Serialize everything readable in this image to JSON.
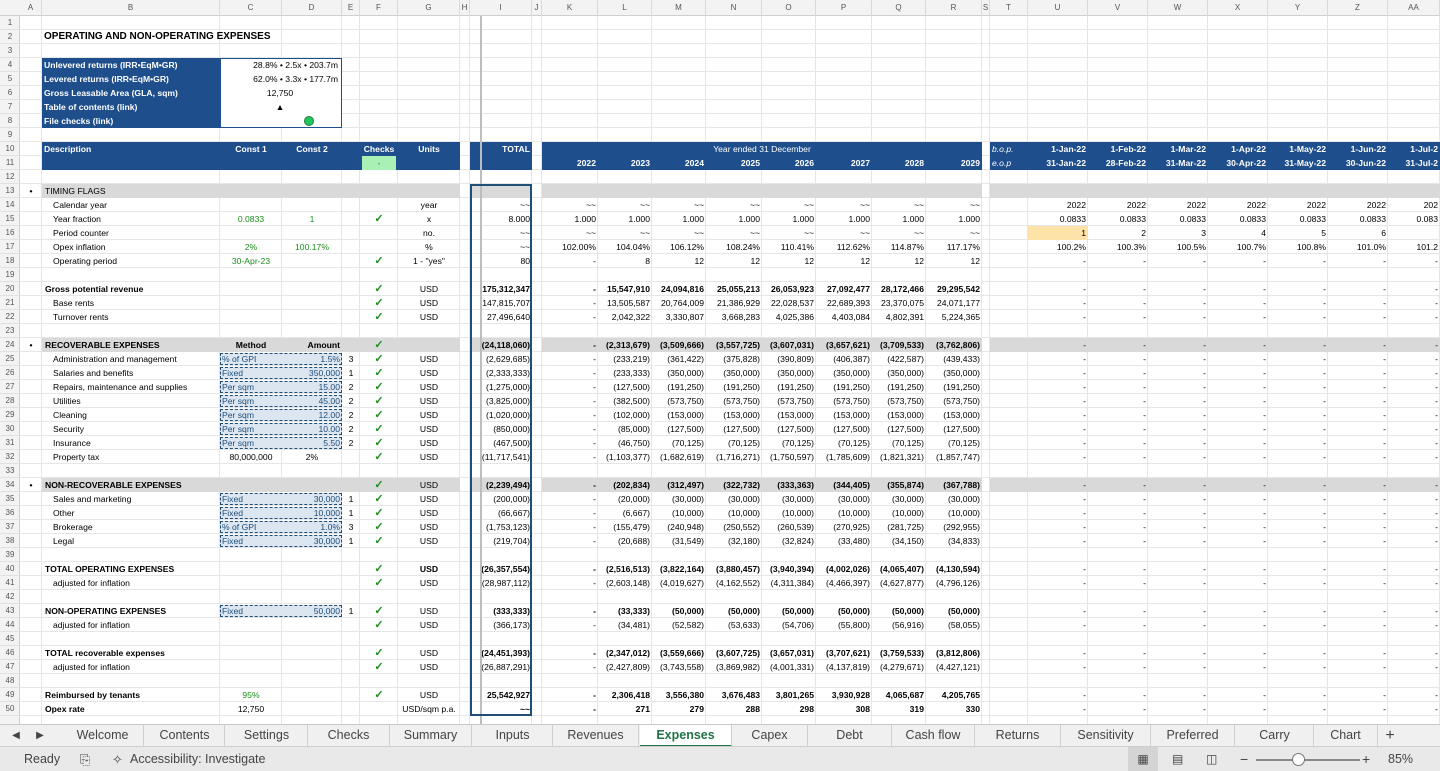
{
  "columns": [
    "A",
    "B",
    "C",
    "D",
    "E",
    "F",
    "G",
    "H",
    "I",
    "J",
    "K",
    "L",
    "M",
    "N",
    "O",
    "P",
    "Q",
    "R",
    "S",
    "T",
    "U",
    "V",
    "W",
    "X",
    "Y",
    "Z",
    "AA"
  ],
  "rows": [
    "1",
    "2",
    "3",
    "4",
    "5",
    "6",
    "7",
    "8",
    "9",
    "10",
    "11",
    "12",
    "13",
    "14",
    "15",
    "16",
    "17",
    "18",
    "19",
    "20",
    "21",
    "22",
    "23",
    "24",
    "25",
    "26",
    "27",
    "28",
    "29",
    "30",
    "31",
    "32",
    "33",
    "34",
    "35",
    "36",
    "37",
    "38",
    "39",
    "40",
    "41",
    "42",
    "43",
    "44",
    "45",
    "46",
    "47",
    "48",
    "49",
    "50"
  ],
  "title": "OPERATING AND NON-OPERATING EXPENSES",
  "summary": [
    {
      "label": "Unlevered returns (IRR•EqM•GR)",
      "value": "28.8% • 2.5x • 203.7m"
    },
    {
      "label": "Levered returns (IRR•EqM•GR)",
      "value": "62.0% • 3.3x • 177.7m"
    },
    {
      "label": "Gross Leasable Area (GLA, sqm)",
      "value": "12,750"
    },
    {
      "label": "Table of contents (link)",
      "value": "▲"
    },
    {
      "label": "File checks (link)",
      "value": ""
    }
  ],
  "header": {
    "description": "Description",
    "const1": "Const 1",
    "const2": "Const 2",
    "checks": "Checks",
    "units": "Units",
    "total": "TOTAL",
    "year_ended": "Year ended 31 December",
    "checks_value": "-",
    "bop": "b.o.p.",
    "eop": "e.o.p"
  },
  "years": [
    "2022",
    "2023",
    "2024",
    "2025",
    "2026",
    "2027",
    "2028",
    "2029"
  ],
  "months_bop": [
    "1-Jan-22",
    "1-Feb-22",
    "1-Mar-22",
    "1-Apr-22",
    "1-May-22",
    "1-Jun-22",
    "1-Jul-2"
  ],
  "months_eop": [
    "31-Jan-22",
    "28-Feb-22",
    "31-Mar-22",
    "30-Apr-22",
    "31-May-22",
    "30-Jun-22",
    "31-Jul-2"
  ],
  "body": [
    {
      "row": 13,
      "style": "grey",
      "bullet": "•",
      "b": "TIMING FLAGS"
    },
    {
      "row": 14,
      "b": "Calendar year",
      "g": "year",
      "i": "~~",
      "years": [
        "~~",
        "~~",
        "~~",
        "~~",
        "~~",
        "~~",
        "~~",
        "~~"
      ],
      "months": [
        "2022",
        "2022",
        "2022",
        "2022",
        "2022",
        "2022",
        "202"
      ]
    },
    {
      "row": 15,
      "b": "Year fraction",
      "c": "0.0833",
      "d": "1",
      "f": "✓",
      "g": "x",
      "i": "8.000",
      "years": [
        "1.000",
        "1.000",
        "1.000",
        "1.000",
        "1.000",
        "1.000",
        "1.000",
        "1.000"
      ],
      "months": [
        "0.0833",
        "0.0833",
        "0.0833",
        "0.0833",
        "0.0833",
        "0.0833",
        "0.083"
      ]
    },
    {
      "row": 16,
      "b": "Period counter",
      "g": "no.",
      "i": "~~",
      "years": [
        "~~",
        "~~",
        "~~",
        "~~",
        "~~",
        "~~",
        "~~",
        "~~"
      ],
      "months": [
        "1",
        "2",
        "3",
        "4",
        "5",
        "6",
        ""
      ]
    },
    {
      "row": 17,
      "b": "Opex inflation",
      "c": "2%",
      "d": "100.17%",
      "g": "%",
      "i": "~~",
      "years": [
        "102.00%",
        "104.04%",
        "106.12%",
        "108.24%",
        "110.41%",
        "112.62%",
        "114.87%",
        "117.17%"
      ],
      "months": [
        "100.2%",
        "100.3%",
        "100.5%",
        "100.7%",
        "100.8%",
        "101.0%",
        "101.2"
      ]
    },
    {
      "row": 18,
      "b": "Operating period",
      "c": "30-Apr-23",
      "f": "✓",
      "g": "1 - \"yes\"",
      "i": "80",
      "years": [
        "-",
        "8",
        "12",
        "12",
        "12",
        "12",
        "12",
        "12"
      ],
      "months": [
        "-",
        "-",
        "-",
        "-",
        "-",
        "-",
        "-"
      ]
    },
    {
      "row": 20,
      "bold": true,
      "b": "Gross potential revenue",
      "f": "✓",
      "g": "USD",
      "i": "175,312,347",
      "years": [
        "-",
        "15,547,910",
        "24,094,816",
        "25,055,213",
        "26,053,923",
        "27,092,477",
        "28,172,466",
        "29,295,542"
      ],
      "months": [
        "-",
        "-",
        "-",
        "-",
        "-",
        "-",
        "-"
      ]
    },
    {
      "row": 21,
      "b": "Base rents",
      "f": "✓",
      "g": "USD",
      "i": "147,815,707",
      "years": [
        "-",
        "13,505,587",
        "20,764,009",
        "21,386,929",
        "22,028,537",
        "22,689,393",
        "23,370,075",
        "24,071,177"
      ],
      "months": [
        "-",
        "-",
        "-",
        "-",
        "-",
        "-",
        "-"
      ]
    },
    {
      "row": 22,
      "b": "Turnover rents",
      "f": "✓",
      "g": "USD",
      "i": "27,496,640",
      "years": [
        "-",
        "2,042,322",
        "3,330,807",
        "3,668,283",
        "4,025,386",
        "4,403,084",
        "4,802,391",
        "5,224,365"
      ],
      "months": [
        "-",
        "-",
        "-",
        "-",
        "-",
        "-",
        "-"
      ]
    },
    {
      "row": 24,
      "style": "grey",
      "bold": true,
      "bullet": "•",
      "b": "RECOVERABLE EXPENSES",
      "c": "Method",
      "d": "Amount",
      "f": "✓",
      "i": "(24,118,060)",
      "years": [
        "-",
        "(2,313,679)",
        "(3,509,666)",
        "(3,557,725)",
        "(3,607,031)",
        "(3,657,621)",
        "(3,709,533)",
        "(3,762,806)"
      ],
      "months": [
        "-",
        "-",
        "-",
        "-",
        "-",
        "-",
        "-"
      ]
    },
    {
      "row": 25,
      "b": "Administration and management",
      "c": "% of GPI",
      "d": "1.5%",
      "e": "3",
      "f": "✓",
      "g": "USD",
      "i": "(2,629,685)",
      "years": [
        "-",
        "(233,219)",
        "(361,422)",
        "(375,828)",
        "(390,809)",
        "(406,387)",
        "(422,587)",
        "(439,433)"
      ],
      "months": [
        "-",
        "-",
        "-",
        "-",
        "-",
        "-",
        "-"
      ]
    },
    {
      "row": 26,
      "b": "Salaries and benefits",
      "c": "Fixed",
      "d": "350,000",
      "e": "1",
      "f": "✓",
      "g": "USD",
      "i": "(2,333,333)",
      "years": [
        "-",
        "(233,333)",
        "(350,000)",
        "(350,000)",
        "(350,000)",
        "(350,000)",
        "(350,000)",
        "(350,000)"
      ],
      "months": [
        "-",
        "-",
        "-",
        "-",
        "-",
        "-",
        "-"
      ]
    },
    {
      "row": 27,
      "b": "Repairs, maintenance and supplies",
      "c": "Per sqm",
      "d": "15.00",
      "e": "2",
      "f": "✓",
      "g": "USD",
      "i": "(1,275,000)",
      "years": [
        "-",
        "(127,500)",
        "(191,250)",
        "(191,250)",
        "(191,250)",
        "(191,250)",
        "(191,250)",
        "(191,250)"
      ],
      "months": [
        "-",
        "-",
        "-",
        "-",
        "-",
        "-",
        "-"
      ]
    },
    {
      "row": 28,
      "b": "Utilities",
      "c": "Per sqm",
      "d": "45.00",
      "e": "2",
      "f": "✓",
      "g": "USD",
      "i": "(3,825,000)",
      "years": [
        "-",
        "(382,500)",
        "(573,750)",
        "(573,750)",
        "(573,750)",
        "(573,750)",
        "(573,750)",
        "(573,750)"
      ],
      "months": [
        "-",
        "-",
        "-",
        "-",
        "-",
        "-",
        "-"
      ]
    },
    {
      "row": 29,
      "b": "Cleaning",
      "c": "Per sqm",
      "d": "12.00",
      "e": "2",
      "f": "✓",
      "g": "USD",
      "i": "(1,020,000)",
      "years": [
        "-",
        "(102,000)",
        "(153,000)",
        "(153,000)",
        "(153,000)",
        "(153,000)",
        "(153,000)",
        "(153,000)"
      ],
      "months": [
        "-",
        "-",
        "-",
        "-",
        "-",
        "-",
        "-"
      ]
    },
    {
      "row": 30,
      "b": "Security",
      "c": "Per sqm",
      "d": "10.00",
      "e": "2",
      "f": "✓",
      "g": "USD",
      "i": "(850,000)",
      "years": [
        "-",
        "(85,000)",
        "(127,500)",
        "(127,500)",
        "(127,500)",
        "(127,500)",
        "(127,500)",
        "(127,500)"
      ],
      "months": [
        "-",
        "-",
        "-",
        "-",
        "-",
        "-",
        "-"
      ]
    },
    {
      "row": 31,
      "b": "Insurance",
      "c": "Per sqm",
      "d": "5.50",
      "e": "2",
      "f": "✓",
      "g": "USD",
      "i": "(467,500)",
      "years": [
        "-",
        "(46,750)",
        "(70,125)",
        "(70,125)",
        "(70,125)",
        "(70,125)",
        "(70,125)",
        "(70,125)"
      ],
      "months": [
        "-",
        "-",
        "-",
        "-",
        "-",
        "-",
        "-"
      ]
    },
    {
      "row": 32,
      "b": "Property tax",
      "c": "80,000,000",
      "d": "2%",
      "f": "✓",
      "g": "USD",
      "i": "(11,717,541)",
      "years": [
        "-",
        "(1,103,377)",
        "(1,682,619)",
        "(1,716,271)",
        "(1,750,597)",
        "(1,785,609)",
        "(1,821,321)",
        "(1,857,747)"
      ],
      "months": [
        "-",
        "-",
        "-",
        "-",
        "-",
        "-",
        "-"
      ]
    },
    {
      "row": 34,
      "style": "grey",
      "bold": true,
      "bullet": "•",
      "b": "NON-RECOVERABLE EXPENSES",
      "f": "✓",
      "g": "USD",
      "i": "(2,239,494)",
      "years": [
        "-",
        "(202,834)",
        "(312,497)",
        "(322,732)",
        "(333,363)",
        "(344,405)",
        "(355,874)",
        "(367,788)"
      ],
      "months": [
        "-",
        "-",
        "-",
        "-",
        "-",
        "-",
        "-"
      ]
    },
    {
      "row": 35,
      "b": "Sales and marketing",
      "c": "Fixed",
      "d": "30,000",
      "e": "1",
      "f": "✓",
      "g": "USD",
      "i": "(200,000)",
      "years": [
        "-",
        "(20,000)",
        "(30,000)",
        "(30,000)",
        "(30,000)",
        "(30,000)",
        "(30,000)",
        "(30,000)"
      ],
      "months": [
        "-",
        "-",
        "-",
        "-",
        "-",
        "-",
        "-"
      ]
    },
    {
      "row": 36,
      "b": "Other",
      "c": "Fixed",
      "d": "10,000",
      "e": "1",
      "f": "✓",
      "g": "USD",
      "i": "(66,667)",
      "years": [
        "-",
        "(6,667)",
        "(10,000)",
        "(10,000)",
        "(10,000)",
        "(10,000)",
        "(10,000)",
        "(10,000)"
      ],
      "months": [
        "-",
        "-",
        "-",
        "-",
        "-",
        "-",
        "-"
      ]
    },
    {
      "row": 37,
      "b": "Brokerage",
      "c": "% of GPI",
      "d": "1.0%",
      "e": "3",
      "f": "✓",
      "g": "USD",
      "i": "(1,753,123)",
      "years": [
        "-",
        "(155,479)",
        "(240,948)",
        "(250,552)",
        "(260,539)",
        "(270,925)",
        "(281,725)",
        "(292,955)"
      ],
      "months": [
        "-",
        "-",
        "-",
        "-",
        "-",
        "-",
        "-"
      ]
    },
    {
      "row": 38,
      "b": "Legal",
      "c": "Fixed",
      "d": "30,000",
      "e": "1",
      "f": "✓",
      "g": "USD",
      "i": "(219,704)",
      "years": [
        "-",
        "(20,688)",
        "(31,549)",
        "(32,180)",
        "(32,824)",
        "(33,480)",
        "(34,150)",
        "(34,833)"
      ],
      "months": [
        "-",
        "-",
        "-",
        "-",
        "-",
        "-",
        "-"
      ]
    },
    {
      "row": 40,
      "bold": true,
      "b": "TOTAL OPERATING EXPENSES",
      "f": "✓",
      "g": "USD",
      "i": "(26,357,554)",
      "years": [
        "-",
        "(2,516,513)",
        "(3,822,164)",
        "(3,880,457)",
        "(3,940,394)",
        "(4,002,026)",
        "(4,065,407)",
        "(4,130,594)"
      ],
      "months": [
        "-",
        "-",
        "-",
        "-",
        "-",
        "-",
        "-"
      ]
    },
    {
      "row": 41,
      "b": "adjusted for inflation",
      "f": "✓",
      "g": "USD",
      "i": "(28,987,112)",
      "years": [
        "-",
        "(2,603,148)",
        "(4,019,627)",
        "(4,162,552)",
        "(4,311,384)",
        "(4,466,397)",
        "(4,627,877)",
        "(4,796,126)"
      ],
      "months": [
        "-",
        "-",
        "-",
        "-",
        "-",
        "-",
        "-"
      ]
    },
    {
      "row": 43,
      "bold": true,
      "b": "NON-OPERATING EXPENSES",
      "c": "Fixed",
      "d": "50,000",
      "e": "1",
      "f": "✓",
      "g": "USD",
      "i": "(333,333)",
      "years": [
        "-",
        "(33,333)",
        "(50,000)",
        "(50,000)",
        "(50,000)",
        "(50,000)",
        "(50,000)",
        "(50,000)"
      ],
      "months": [
        "-",
        "-",
        "-",
        "-",
        "-",
        "-",
        "-"
      ]
    },
    {
      "row": 44,
      "b": "adjusted for inflation",
      "f": "✓",
      "g": "USD",
      "i": "(366,173)",
      "years": [
        "-",
        "(34,481)",
        "(52,582)",
        "(53,633)",
        "(54,706)",
        "(55,800)",
        "(56,916)",
        "(58,055)"
      ],
      "months": [
        "-",
        "-",
        "-",
        "-",
        "-",
        "-",
        "-"
      ]
    },
    {
      "row": 46,
      "bold": true,
      "b": "TOTAL recoverable expenses",
      "f": "✓",
      "g": "USD",
      "i": "(24,451,393)",
      "years": [
        "-",
        "(2,347,012)",
        "(3,559,666)",
        "(3,607,725)",
        "(3,657,031)",
        "(3,707,621)",
        "(3,759,533)",
        "(3,812,806)"
      ],
      "months": [
        "-",
        "-",
        "-",
        "-",
        "-",
        "-",
        "-"
      ]
    },
    {
      "row": 47,
      "b": "adjusted for inflation",
      "f": "✓",
      "g": "USD",
      "i": "(26,887,291)",
      "years": [
        "-",
        "(2,427,809)",
        "(3,743,558)",
        "(3,869,982)",
        "(4,001,331)",
        "(4,137,819)",
        "(4,279,671)",
        "(4,427,121)"
      ],
      "months": [
        "-",
        "-",
        "-",
        "-",
        "-",
        "-",
        "-"
      ]
    },
    {
      "row": 49,
      "bold": true,
      "b": "Reimbursed by tenants",
      "c": "95%",
      "f": "✓",
      "g": "USD",
      "i": "25,542,927",
      "years": [
        "-",
        "2,306,418",
        "3,556,380",
        "3,676,483",
        "3,801,265",
        "3,930,928",
        "4,065,687",
        "4,205,765"
      ],
      "months": [
        "-",
        "-",
        "-",
        "-",
        "-",
        "-",
        "-"
      ]
    },
    {
      "row": 50,
      "bold": true,
      "b": "Opex rate",
      "c": "12,750",
      "g": "USD/sqm p.a.",
      "i": "~~",
      "years": [
        "-",
        "271",
        "279",
        "288",
        "298",
        "308",
        "319",
        "330"
      ],
      "months": [
        "-",
        "-",
        "-",
        "-",
        "-",
        "-",
        "-"
      ]
    }
  ],
  "tabs": [
    "Welcome",
    "Contents",
    "Settings",
    "Checks",
    "Summary",
    "Inputs",
    "Revenues",
    "Expenses",
    "Capex",
    "Debt",
    "Cash flow",
    "Returns",
    "Sensitivity",
    "Preferred",
    "Carry",
    "Chart"
  ],
  "active_tab": "Expenses",
  "status": {
    "ready": "Ready",
    "accessibility": "Accessibility: Investigate",
    "zoom": "85%"
  },
  "colors": {
    "header_blue": "#1e4e8c",
    "accent_green": "#217346",
    "check_green": "#1a8f1a"
  }
}
